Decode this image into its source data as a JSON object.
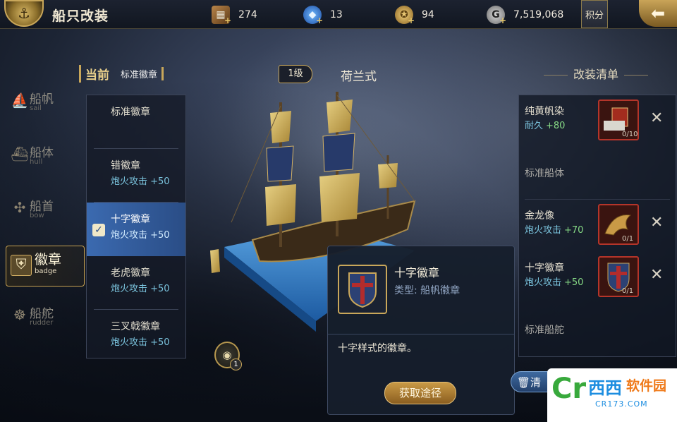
{
  "header": {
    "title": "船只改装",
    "resources": [
      {
        "icon": "chest-icon",
        "value": "274"
      },
      {
        "icon": "blue-crystal-icon",
        "value": "13"
      },
      {
        "icon": "gold-medal-icon",
        "value": "94"
      },
      {
        "icon": "coin-icon",
        "value": "7,519,068"
      }
    ],
    "score_label": "积分"
  },
  "nav": [
    {
      "label": "船帆",
      "sub": "sail",
      "icon": "sail-icon",
      "active": false
    },
    {
      "label": "船体",
      "sub": "hull",
      "icon": "hull-icon",
      "active": false
    },
    {
      "label": "船首",
      "sub": "bow",
      "icon": "bow-icon",
      "active": false
    },
    {
      "label": "徽章",
      "sub": "badge",
      "icon": "badge-icon",
      "active": true
    },
    {
      "label": "船舵",
      "sub": "rudder",
      "icon": "rudder-icon",
      "active": false
    }
  ],
  "current": {
    "label": "当前",
    "value": "标准徽章"
  },
  "badge_list": [
    {
      "name": "标准徽章",
      "stat": ""
    },
    {
      "name": "错徽章",
      "stat": "炮火攻击 +50"
    },
    {
      "name": "十字徽章",
      "stat": "炮火攻击 +50",
      "selected": true
    },
    {
      "name": "老虎徽章",
      "stat": "炮火攻击 +50"
    },
    {
      "name": "三叉戟徽章",
      "stat": "炮火攻击 +50"
    }
  ],
  "ship": {
    "level": "1级",
    "name": "荷兰式"
  },
  "eye_badge": "1",
  "tooltip": {
    "title": "十字徽章",
    "type": "类型: 船帆徽章",
    "desc": "十字样式的徽章。",
    "button": "获取途径"
  },
  "mod_list": {
    "title": "改装清单",
    "items": [
      {
        "name": "纯黄帆染",
        "attr": "耐久",
        "val": "+80",
        "count": "0/10"
      },
      {
        "name": "标准船体"
      },
      {
        "name": "金龙像",
        "attr": "炮火攻击",
        "val": "+70",
        "count": "0/1"
      },
      {
        "name": "十字徽章",
        "attr": "炮火攻击",
        "val": "+50",
        "count": "0/1"
      },
      {
        "name": "标准船舵"
      }
    ]
  },
  "clear_label": "清",
  "watermark": {
    "logo": "Cr",
    "brand": "西西",
    "text": "软件园",
    "url": "CR173.COM"
  }
}
